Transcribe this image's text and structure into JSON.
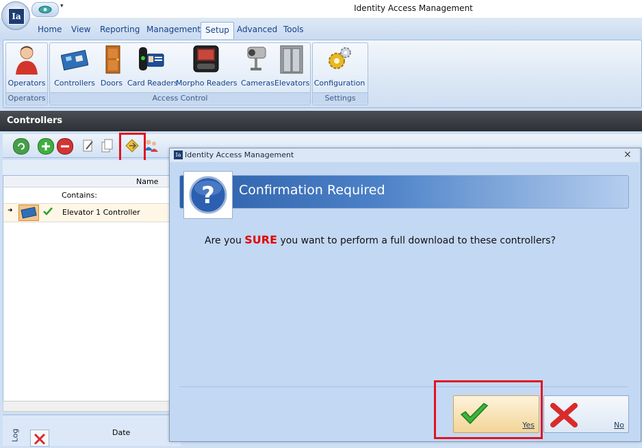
{
  "window": {
    "title": "Identity Access Management",
    "logo_text": "Ia"
  },
  "tabs": [
    "Home",
    "View",
    "Reporting",
    "Management",
    "Setup",
    "Advanced",
    "Tools"
  ],
  "active_tab": "Setup",
  "ribbon": {
    "groups": [
      {
        "label": "Operators",
        "buttons": [
          {
            "label": "Operators",
            "icon": "operator-icon"
          }
        ]
      },
      {
        "label": "Access Control",
        "buttons": [
          {
            "label": "Controllers",
            "icon": "controller-board-icon"
          },
          {
            "label": "Doors",
            "icon": "door-icon"
          },
          {
            "label": "Card Readers",
            "icon": "card-reader-icon"
          },
          {
            "label": "Morpho Readers",
            "icon": "morpho-reader-icon"
          },
          {
            "label": "Cameras",
            "icon": "camera-icon"
          },
          {
            "label": "Elevators",
            "icon": "elevator-icon"
          }
        ]
      },
      {
        "label": "Settings",
        "buttons": [
          {
            "label": "Configuration",
            "icon": "gears-icon"
          }
        ]
      }
    ]
  },
  "controllers": {
    "header": "Controllers",
    "columns": {
      "name": "Name"
    },
    "filter_label": "Contains:",
    "rows": [
      {
        "name": "Elevator 1 Controller",
        "status": "ok"
      }
    ]
  },
  "log": {
    "tab": "Log",
    "columns": {
      "date": "Date"
    }
  },
  "dialog": {
    "title": "Identity Access Management",
    "close": "×",
    "banner_title": "Confirmation Required",
    "message_before": "Are you ",
    "message_emph": "SURE",
    "message_after": " you want to perform a full download to these controllers?",
    "yes_label": "Yes",
    "no_label": "No"
  },
  "colors": {
    "accent": "#2b5fa8",
    "highlight": "#e0141f",
    "ok": "#2e9e2e",
    "cancel": "#d92b2b"
  }
}
